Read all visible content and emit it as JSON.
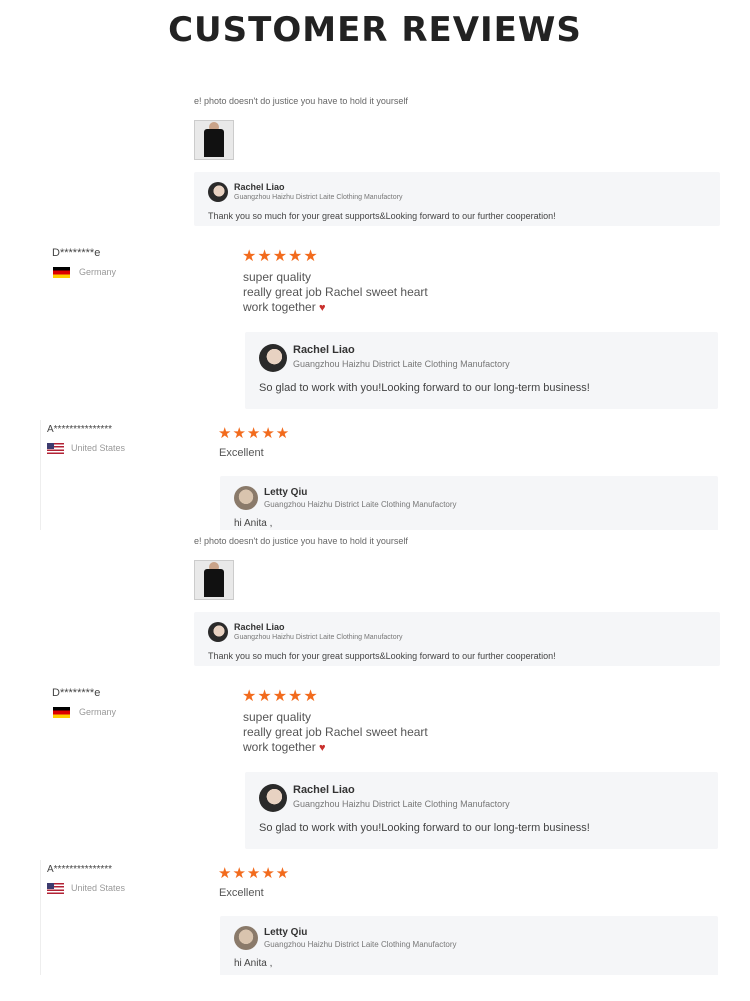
{
  "header": {
    "title": "CUSTOMER REVIEWS"
  },
  "review_block": {
    "top_fragment": "e! photo doesn't do justice you have to hold it yourself",
    "reply_1": {
      "name": "Rachel Liao",
      "company": "Guangzhou Haizhu District Laite Clothing Manufactory",
      "message": "Thank you so much for your great supports&Looking forward to our further cooperation!"
    },
    "review_2": {
      "user": "D********e",
      "country": "Germany",
      "stars": "★★★★★",
      "lines": [
        "super quality",
        "really great job Rachel sweet heart",
        "work together"
      ],
      "heart": "♥"
    },
    "reply_2": {
      "name": "Rachel Liao",
      "company": "Guangzhou Haizhu District Laite Clothing Manufactory",
      "message": "So glad to work with you!Looking forward to our long-term business!"
    },
    "review_3": {
      "user": "A***************",
      "country": "United States",
      "stars": "★★★★★",
      "text": "Excellent"
    },
    "reply_3": {
      "name": "Letty Qiu",
      "company": "Guangzhou Haizhu District Laite Clothing Manufactory",
      "message": "hi Anita ,"
    }
  },
  "icons": {
    "flag_germany": "germany-flag-icon",
    "flag_us": "us-flag-icon",
    "star": "star-icon",
    "heart": "heart-icon"
  },
  "colors": {
    "star": "#f26b1d",
    "reply_bg": "#f5f6f8",
    "heart": "#c9302c"
  }
}
